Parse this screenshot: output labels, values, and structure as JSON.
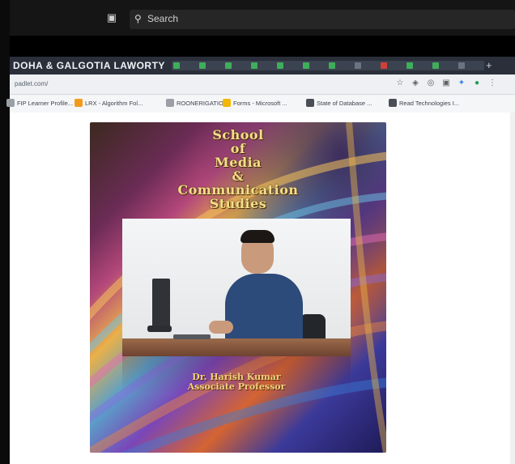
{
  "taskbar": {
    "search_label": "Search",
    "search_icon": "search-icon",
    "copilot_icon": "copilot-icon"
  },
  "browser": {
    "active_tab_title": "DOHA & GALGOTIA LAWORTY",
    "url": "padlet.com/",
    "tab_colors": [
      "#3fae5a",
      "#3fae5a",
      "#3fae5a",
      "#3fae5a",
      "#3fae5a",
      "#3fae5a",
      "#3fae5a",
      "#6b7280",
      "#d0403a",
      "#3fae5a",
      "#3fae5a",
      "#6b7280"
    ],
    "toolbar_icons": [
      "star-icon",
      "shield-icon",
      "extensions-icon",
      "sidebar-icon",
      "puzzle-icon",
      "profile-icon",
      "menu-icon"
    ],
    "bookmarks": [
      {
        "label": "FIP Learner Profile...",
        "color": "#9aa0a6"
      },
      {
        "label": "LRX - Algorithm Fol...",
        "color": "#f29b1b"
      },
      {
        "label": "ROONERIGATION",
        "color": "#9aa0a6"
      },
      {
        "label": "Forms - Microsoft ...",
        "color": "#f2b705"
      },
      {
        "label": "State of Database ...",
        "color": "#4a4f57"
      },
      {
        "label": "Read Technologies I...",
        "color": "#4a4f57"
      }
    ]
  },
  "poster": {
    "title_lines": [
      "School",
      "of",
      "Media",
      "&",
      "Communication",
      "Studies"
    ],
    "caption_name": "Dr. Harish Kumar",
    "caption_role": "Associate Professor"
  }
}
